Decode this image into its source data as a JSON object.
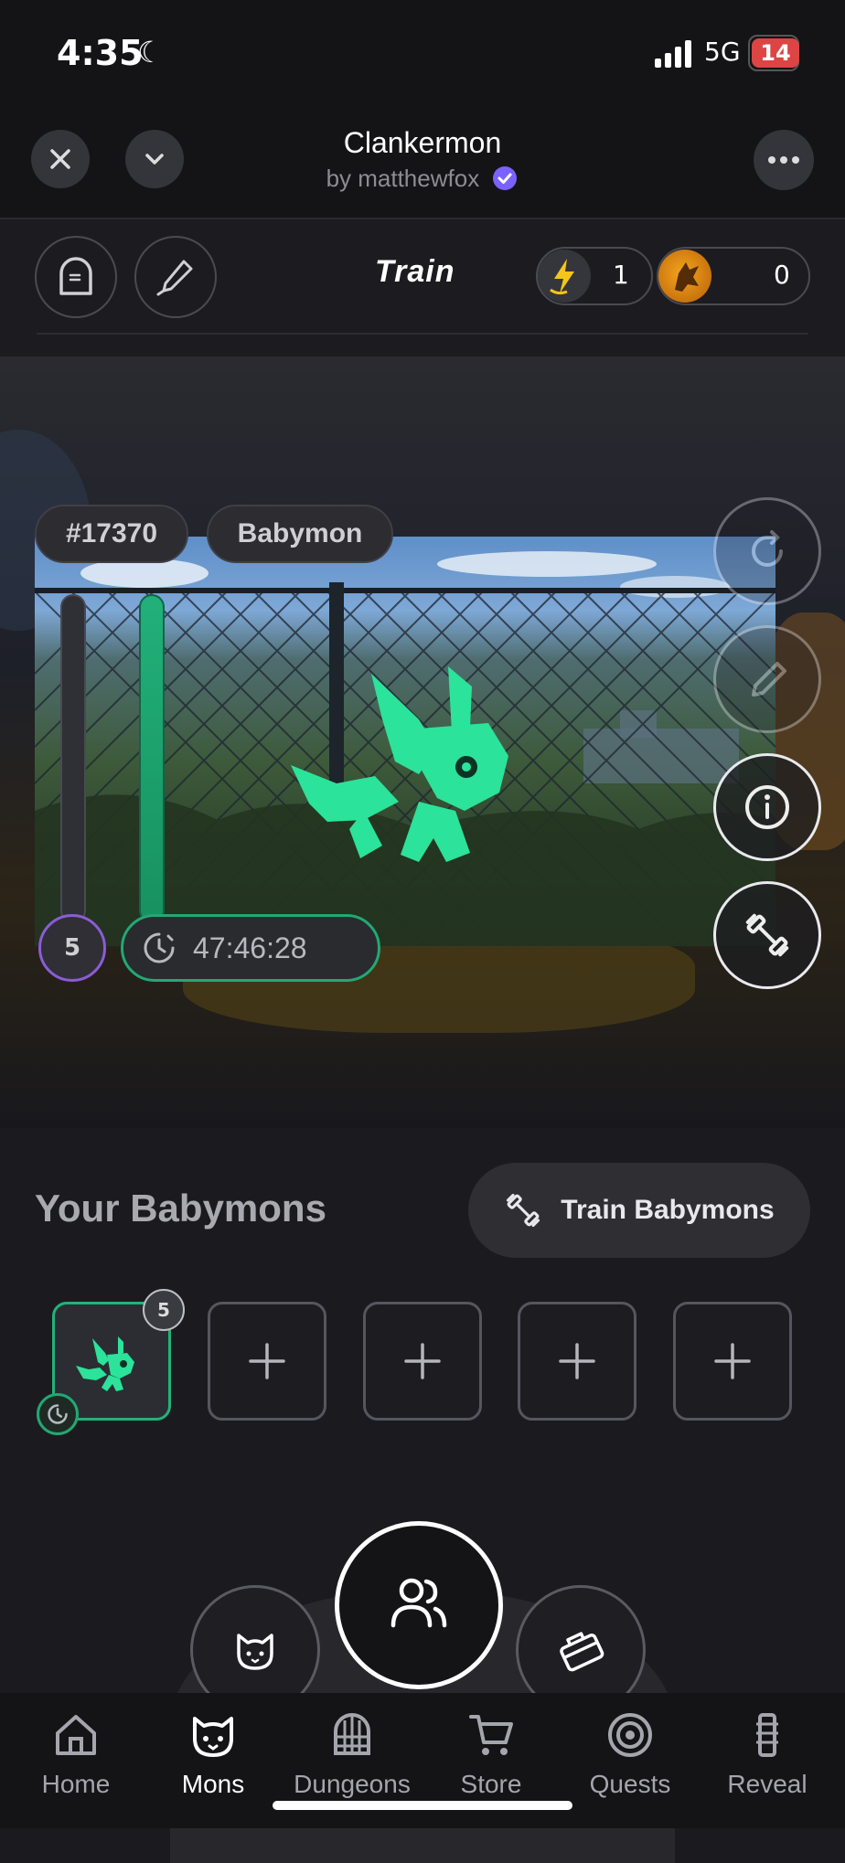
{
  "status_bar": {
    "time": "4:35",
    "network": "5G",
    "battery": "14"
  },
  "header": {
    "title": "Clankermon",
    "subtitle": "by matthewfox"
  },
  "toolbar": {
    "mode_title": "Train",
    "energy_count": "1",
    "coin_count": "0"
  },
  "stage": {
    "id_tag": "#17370",
    "stage_tag": "Babymon",
    "level": "5",
    "timer": "47:46:28"
  },
  "section": {
    "title": "Your Babymons",
    "train_button": "Train Babymons",
    "slot_count": "5",
    "slots": [
      "+",
      "+",
      "+",
      "+"
    ]
  },
  "nav": {
    "items": [
      {
        "label": "Home",
        "icon": "home-icon"
      },
      {
        "label": "Mons",
        "icon": "cat-icon"
      },
      {
        "label": "Dungeons",
        "icon": "gate-icon"
      },
      {
        "label": "Store",
        "icon": "cart-icon"
      },
      {
        "label": "Quests",
        "icon": "target-icon"
      },
      {
        "label": "Reveal",
        "icon": "reveal-icon"
      }
    ],
    "active": "Mons"
  },
  "colors": {
    "accent_green": "#22b07a",
    "level_ring": "#8b5cd6",
    "verified": "#7b61ff",
    "creature": "#2be39a"
  }
}
